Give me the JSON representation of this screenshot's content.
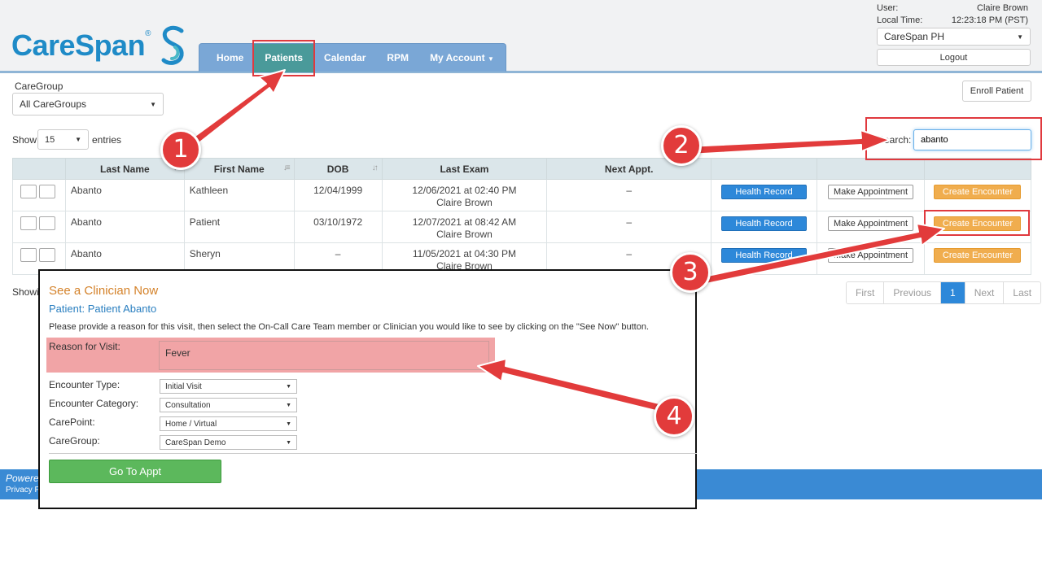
{
  "brand": {
    "name": "CareSpan",
    "reg": "®",
    "color": "#1f8bc7"
  },
  "nav": {
    "items": [
      {
        "label": "Home"
      },
      {
        "label": "Patients",
        "active": true
      },
      {
        "label": "Calendar"
      },
      {
        "label": "RPM"
      },
      {
        "label": "My Account"
      }
    ]
  },
  "user": {
    "user_label": "User:",
    "user_name": "Claire Brown",
    "time_label": "Local Time:",
    "time_value": "12:23:18 PM (PST)",
    "org_select": "CareSpan PH",
    "logout_label": "Logout"
  },
  "controls": {
    "caregroup_label": "CareGroup",
    "caregroup_value": "All CareGroups",
    "enroll_label": "Enroll Patient",
    "show_label": "Show",
    "entries_value": "15",
    "entries_label": "entries",
    "search_label": "Search:",
    "search_value": "abanto"
  },
  "table": {
    "columns": [
      "Last Name",
      "First Name",
      "DOB",
      "Last Exam",
      "Next Appt."
    ],
    "rows": [
      {
        "last": "Abanto",
        "first": "Kathleen",
        "dob": "12/04/1999",
        "exam_date": "12/06/2021 at 02:40 PM",
        "exam_by": "Claire Brown",
        "next": "–"
      },
      {
        "last": "Abanto",
        "first": "Patient",
        "dob": "03/10/1972",
        "exam_date": "12/07/2021 at 08:42 AM",
        "exam_by": "Claire Brown",
        "next": "–"
      },
      {
        "last": "Abanto",
        "first": "Sheryn",
        "dob": "–",
        "exam_date": "11/05/2021 at 04:30 PM",
        "exam_by": "Claire Brown",
        "next": "–"
      }
    ],
    "health_record_label": "Health Record",
    "make_appt_label": "Make Appointment",
    "create_enc_label": "Create Encounter",
    "showing_text": "Showi"
  },
  "pager": {
    "first": "First",
    "previous": "Previous",
    "current": "1",
    "next": "Next",
    "last": "Last"
  },
  "footer": {
    "powered": "Powere",
    "privacy": "Privacy P"
  },
  "modal": {
    "title": "See a Clinician Now",
    "patient": "Patient: Patient Abanto",
    "instructions": "Please provide a reason for this visit, then select the On-Call Care Team member or Clinician you would like to see by clicking on the \"See Now\" button.",
    "reason_label": "Reason for Visit:",
    "reason_value": "Fever",
    "encounter_type_label": "Encounter Type:",
    "encounter_type_value": "Initial Visit",
    "encounter_category_label": "Encounter Category:",
    "encounter_category_value": "Consultation",
    "carepoint_label": "CarePoint:",
    "carepoint_value": "Home / Virtual",
    "caregroup_label": "CareGroup:",
    "caregroup_value": "CareSpan Demo",
    "go_label": "Go To Appt"
  },
  "annotations": {
    "steps": [
      "1",
      "2",
      "3",
      "4"
    ],
    "color": "#e23b3b"
  }
}
